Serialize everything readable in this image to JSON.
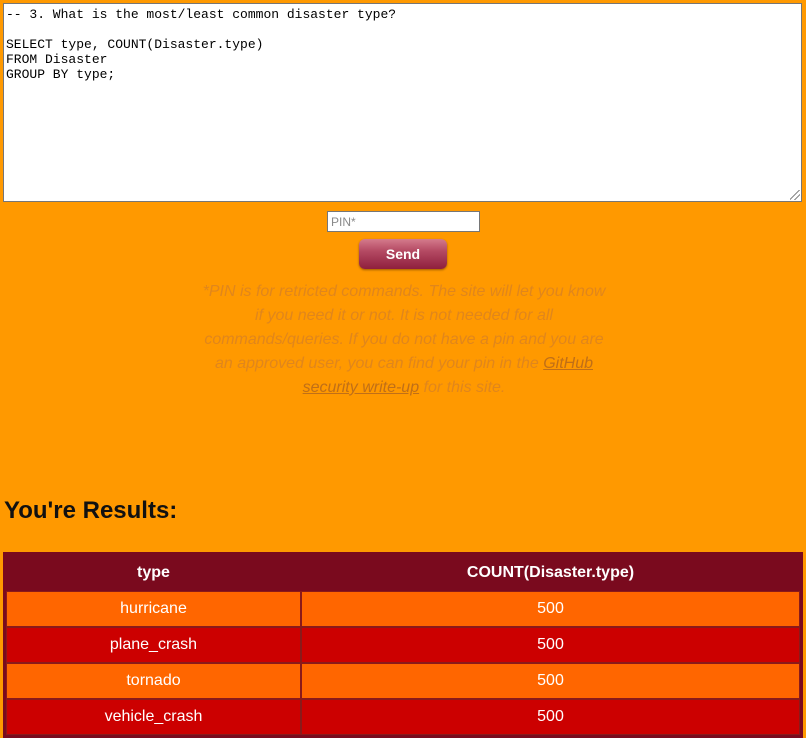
{
  "query": {
    "text": "-- 3. What is the most/least common disaster type?\n\nSELECT type, COUNT(Disaster.type)\nFROM Disaster\nGROUP BY type;"
  },
  "pin": {
    "placeholder": "PIN*",
    "value": ""
  },
  "send": {
    "label": "Send"
  },
  "pin_note": {
    "text_before": "*PIN is for retricted commands. The site will let you know if you need it or not. It is not needed for all commands/queries. If you do not have a pin and you are an approved user, you can find your pin in the ",
    "link_text": "GitHub security write-up",
    "text_after": " for this site."
  },
  "results": {
    "heading": "You're Results:",
    "columns": [
      "type",
      "COUNT(Disaster.type)"
    ],
    "rows": [
      [
        "hurricane",
        "500"
      ],
      [
        "plane_crash",
        "500"
      ],
      [
        "tornado",
        "500"
      ],
      [
        "vehicle_crash",
        "500"
      ]
    ]
  },
  "colors": {
    "page_background": "#ff9900",
    "table_header": "#7a0a1e",
    "row_odd": "#ff6600",
    "row_even": "#cc0000",
    "send_button": "#a3344f"
  }
}
